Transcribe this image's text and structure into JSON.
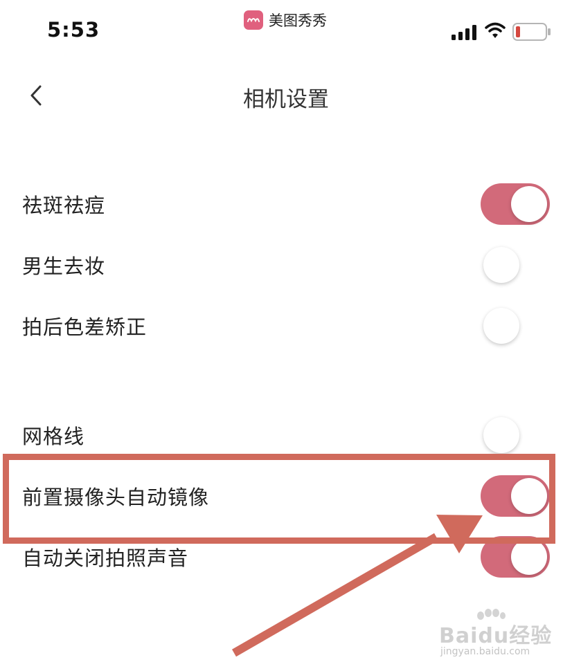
{
  "status_bar": {
    "time": "5:53",
    "app_name": "美图秀秀",
    "app_icon": "meitu-app-icon",
    "signal_icon": "cellular-signal-icon",
    "wifi_icon": "wifi-icon",
    "battery_icon": "battery-low-icon"
  },
  "nav": {
    "back_icon": "chevron-left-icon",
    "title": "相机设置"
  },
  "settings": [
    {
      "label": "祛斑祛痘",
      "enabled": true
    },
    {
      "label": "男生去妆",
      "enabled": false
    },
    {
      "label": "拍后色差矫正",
      "enabled": false
    },
    {
      "label": "网格线",
      "enabled": false
    },
    {
      "label": "前置摄像头自动镜像",
      "enabled": true
    },
    {
      "label": "自动关闭拍照声音",
      "enabled": true
    }
  ],
  "annotation": {
    "highlighted_setting": "前置摄像头自动镜像",
    "color": "#d06a5c"
  },
  "watermark": {
    "main": "Baidu经验",
    "sub": "jingyan.baidu.com"
  },
  "colors": {
    "toggle_on": "#d26a7a",
    "accent": "#e0607e"
  }
}
